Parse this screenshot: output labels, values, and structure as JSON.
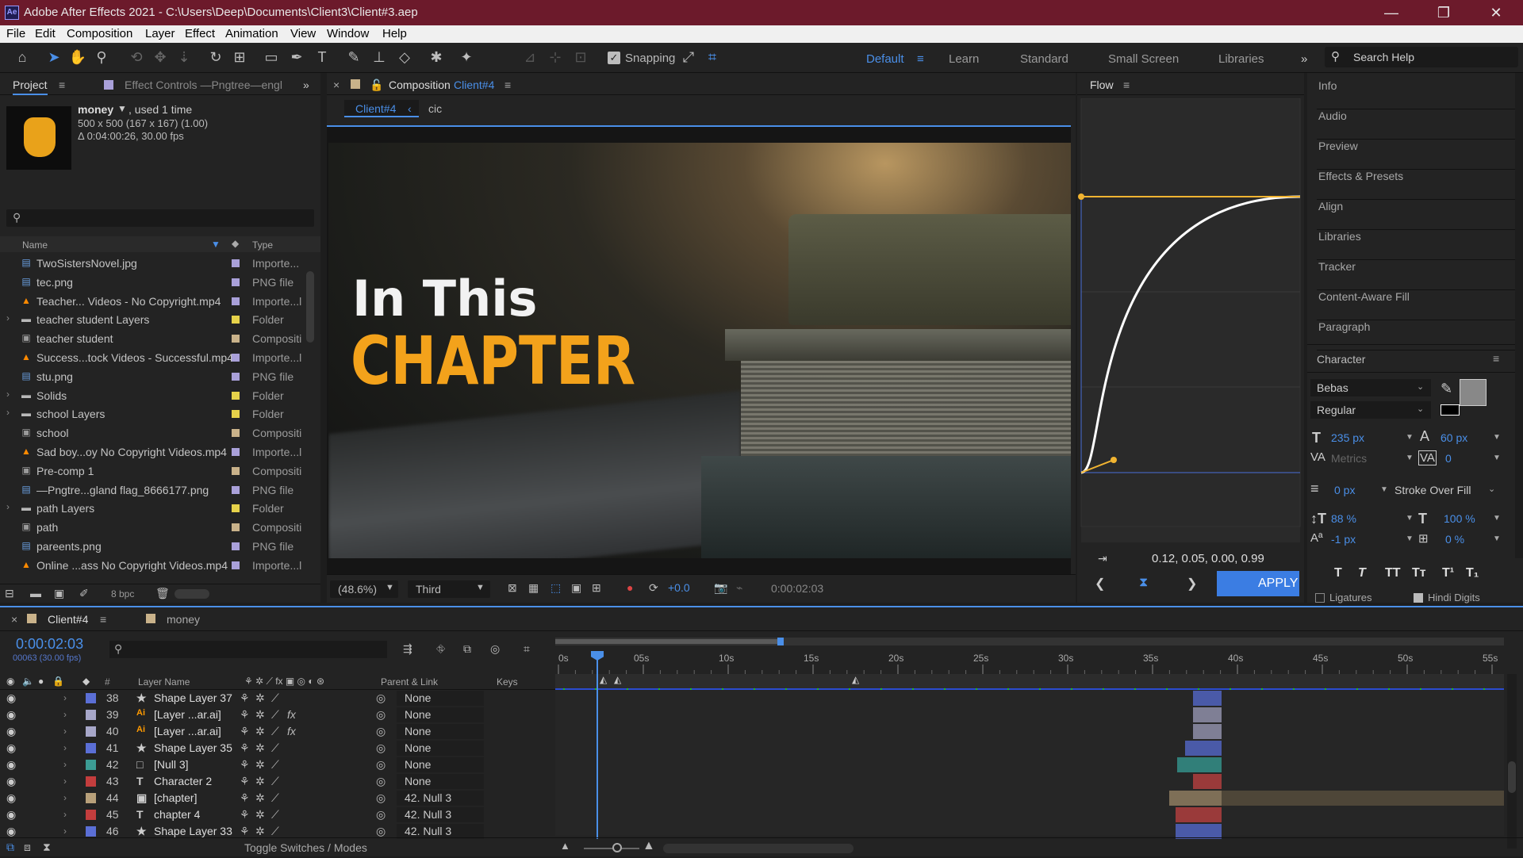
{
  "window": {
    "app_icon": "Ae",
    "title": "Adobe After Effects 2021 - C:\\Users\\Deep\\Documents\\Client3\\Client#3.aep",
    "minimize": "—",
    "maximize": "❐",
    "close": "✕"
  },
  "menu": [
    "File",
    "Edit",
    "Composition",
    "Layer",
    "Effect",
    "Animation",
    "View",
    "Window",
    "Help"
  ],
  "toolbar": {
    "snapping_label": "Snapping",
    "workspaces": [
      "Default",
      "Learn",
      "Standard",
      "Small Screen",
      "Libraries"
    ],
    "active_workspace": "Default",
    "search_placeholder": "Search Help"
  },
  "project_panel": {
    "tab_project": "Project",
    "tab_effect_controls": "Effect Controls —Pngtree—engl",
    "item_name": "money",
    "item_used": ", used 1 time",
    "item_dims": "500 x 500  (167 x 167) (1.00)",
    "item_duration": "Δ 0:04:00:26, 30.00 fps",
    "col_name": "Name",
    "col_type": "Type",
    "bpc": "8 bpc",
    "items": [
      {
        "name": "TwoSistersNovel.jpg",
        "type": "Importe...",
        "icon": "image-file-icon",
        "label": "#a9a0d9"
      },
      {
        "name": "tec.png",
        "type": "PNG file",
        "icon": "image-file-icon",
        "label": "#a9a0d9"
      },
      {
        "name": "Teacher... Videos - No Copyright.mp4",
        "type": "Importe...l",
        "icon": "vlc-media-icon",
        "label": "#a9a0d9"
      },
      {
        "name": "teacher student Layers",
        "type": "Folder",
        "icon": "folder-icon",
        "label": "#e6d24a"
      },
      {
        "name": "teacher student",
        "type": "Compositi",
        "icon": "composition-icon",
        "label": "#c9b28a"
      },
      {
        "name": "Success...tock Videos - Successful.mp4",
        "type": "Importe...l",
        "icon": "vlc-media-icon",
        "label": "#a9a0d9"
      },
      {
        "name": "stu.png",
        "type": "PNG file",
        "icon": "image-file-icon",
        "label": "#a9a0d9"
      },
      {
        "name": "Solids",
        "type": "Folder",
        "icon": "folder-icon",
        "label": "#e6d24a"
      },
      {
        "name": "school Layers",
        "type": "Folder",
        "icon": "folder-icon",
        "label": "#e6d24a"
      },
      {
        "name": "school",
        "type": "Compositi",
        "icon": "composition-icon",
        "label": "#c9b28a"
      },
      {
        "name": "Sad boy...oy No Copyright Videos.mp4",
        "type": "Importe...l",
        "icon": "vlc-media-icon",
        "label": "#a9a0d9"
      },
      {
        "name": "Pre-comp 1",
        "type": "Compositi",
        "icon": "composition-icon",
        "label": "#c9b28a"
      },
      {
        "name": "—Pngtre...gland flag_8666177.png",
        "type": "PNG file",
        "icon": "image-file-icon",
        "label": "#a9a0d9"
      },
      {
        "name": "path Layers",
        "type": "Folder",
        "icon": "folder-icon",
        "label": "#e6d24a"
      },
      {
        "name": "path",
        "type": "Compositi",
        "icon": "composition-icon",
        "label": "#c9b28a"
      },
      {
        "name": "pareents.png",
        "type": "PNG file",
        "icon": "image-file-icon",
        "label": "#a9a0d9"
      },
      {
        "name": "Online ...ass No Copyright Videos.mp4",
        "type": "Importe...l",
        "icon": "vlc-media-icon",
        "label": "#a9a0d9"
      }
    ]
  },
  "composition_panel": {
    "tab_prefix": "Composition",
    "tab_name": "Client#4",
    "breadcrumb_current": "Client#4",
    "breadcrumb_next": "cic",
    "video_line1": "In This",
    "video_line2": "CHAPTER",
    "zoom": "(48.6%)",
    "resolution": "Third",
    "exposure": "+0.0",
    "timecode": "0:00:02:03"
  },
  "flow_panel": {
    "title": "Flow",
    "bezier": "0.12, 0.05, 0.00, 0.99",
    "apply": "APPLY"
  },
  "right_panels": [
    "Info",
    "Audio",
    "Preview",
    "Effects & Presets",
    "Align",
    "Libraries",
    "Tracker",
    "Content-Aware Fill",
    "Paragraph"
  ],
  "character_panel": {
    "title": "Character",
    "font": "Bebas",
    "style": "Regular",
    "size": "235 px",
    "leading": "60 px",
    "kerning": "Metrics",
    "tracking": "0",
    "stroke_width": "0 px",
    "stroke_mode": "Stroke Over Fill",
    "vscale": "88 %",
    "hscale": "100 %",
    "baseline": "-1 px",
    "tsume": "0 %",
    "ligatures": "Ligatures",
    "hindi_digits": "Hindi Digits"
  },
  "timeline": {
    "tab_comp": "Client#4",
    "tab_other": "money",
    "timecode": "0:00:02:03",
    "frames": "00063 (30.00 fps)",
    "col_layer_name": "Layer Name",
    "col_parent": "Parent & Link",
    "col_keys": "Keys",
    "ruler": [
      "0s",
      "05s",
      "10s",
      "15s",
      "20s",
      "25s",
      "30s",
      "35s",
      "40s",
      "45s",
      "50s",
      "55s"
    ],
    "toggle_label": "Toggle Switches / Modes",
    "layers": [
      {
        "num": "38",
        "name": "Shape Layer 37",
        "icon": "star-shape-icon",
        "label": "#5b6fd6",
        "parent": "None",
        "fx": false,
        "bar": "#4a5aa8"
      },
      {
        "num": "39",
        "name": "[Layer ...ar.ai]",
        "icon": "illustrator-file-icon",
        "label": "#a7a7c9",
        "parent": "None",
        "fx": true,
        "bar": "#7f7f95"
      },
      {
        "num": "40",
        "name": "[Layer ...ar.ai]",
        "icon": "illustrator-file-icon",
        "label": "#a7a7c9",
        "parent": "None",
        "fx": true,
        "bar": "#7f7f95"
      },
      {
        "num": "41",
        "name": "Shape Layer 35",
        "icon": "star-shape-icon",
        "label": "#5b6fd6",
        "parent": "None",
        "fx": false,
        "bar": "#4a5aa8"
      },
      {
        "num": "42",
        "name": "[Null 3]",
        "icon": "null-object-icon",
        "label": "#3c9c94",
        "parent": "None",
        "fx": false,
        "bar": "#317f79"
      },
      {
        "num": "43",
        "name": "Character 2",
        "icon": "text-layer-icon",
        "label": "#c33d3d",
        "parent": "None",
        "fx": false,
        "bar": "#9a3a3a"
      },
      {
        "num": "44",
        "name": "[chapter]",
        "icon": "composition-icon",
        "label": "#b8a07a",
        "parent": "42. Null 3",
        "fx": false,
        "bar": "#7e6f57"
      },
      {
        "num": "45",
        "name": "chapter 4",
        "icon": "text-layer-icon",
        "label": "#c33d3d",
        "parent": "42. Null 3",
        "fx": false,
        "bar": "#9a3a3a"
      },
      {
        "num": "46",
        "name": "Shape Layer 33",
        "icon": "star-shape-icon",
        "label": "#5b6fd6",
        "parent": "42. Null 3",
        "fx": false,
        "bar": "#4a5aa8"
      }
    ]
  },
  "colors": {
    "accent": "#4a8fe8",
    "title_bar": "#6c1a2b",
    "chapter_text": "#f3a21b",
    "curve_handle": "#f1b431"
  }
}
